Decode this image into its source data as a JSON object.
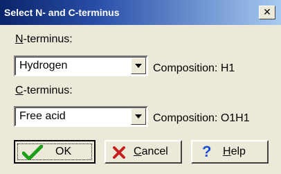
{
  "window": {
    "title": "Select N- and C-terminus",
    "close_glyph": "✕"
  },
  "n_terminus": {
    "label_accel": "N",
    "label_rest": "-terminus:",
    "value": "Hydrogen",
    "composition": "Composition: H1"
  },
  "c_terminus": {
    "label_accel": "C",
    "label_rest": "-terminus:",
    "value": "Free acid",
    "composition": "Composition: O1H1"
  },
  "buttons": {
    "ok": {
      "label": "OK",
      "icon": "checkmark-icon",
      "color": "#1a9e1a"
    },
    "cancel": {
      "label_accel": "C",
      "label_rest": "ancel",
      "icon": "x-icon",
      "color": "#c41e1e"
    },
    "help": {
      "label_accel": "H",
      "label_rest": "elp",
      "icon": "question-icon",
      "glyph": "?",
      "color": "#1a4fd6"
    }
  }
}
